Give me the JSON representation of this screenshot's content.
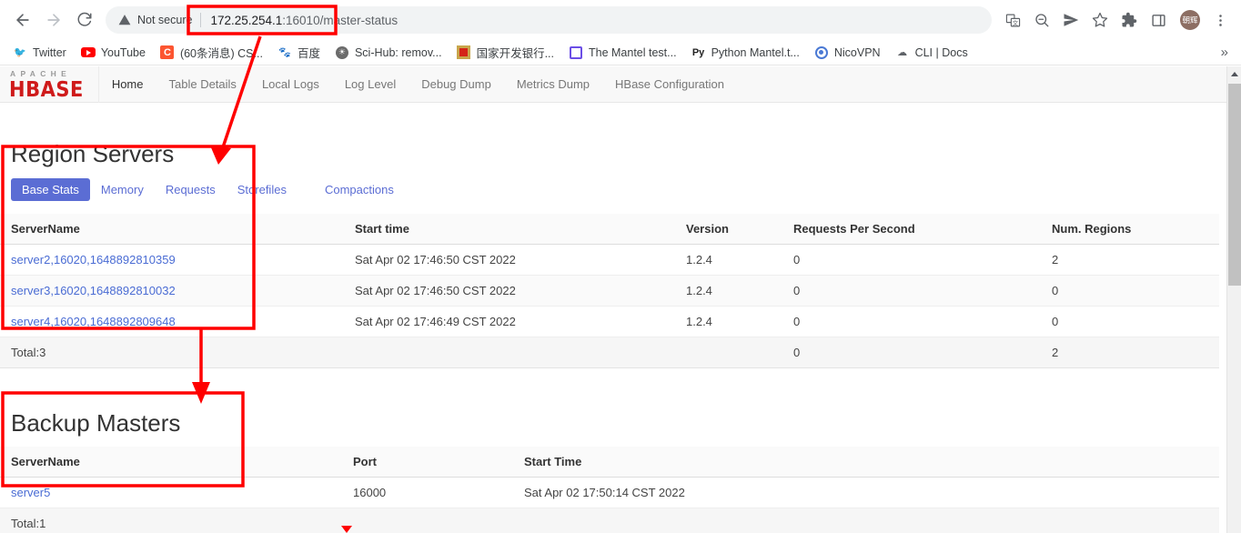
{
  "browser": {
    "back_label": "Back",
    "forward_label": "Forward",
    "reload_label": "Reload",
    "security_label": "Not secure",
    "url_host": "172.25.254.1",
    "url_rest": ":16010/master-status",
    "toolbar_icons": [
      {
        "name": "translate-icon",
        "glyph": "文"
      },
      {
        "name": "zoom-out-icon",
        "glyph": "-"
      },
      {
        "name": "send-icon",
        "glyph": "➤"
      },
      {
        "name": "bookmark-star-icon",
        "glyph": "☆"
      },
      {
        "name": "extensions-puzzle-icon",
        "glyph": "🧩"
      },
      {
        "name": "side-panel-icon",
        "glyph": "▢"
      }
    ],
    "avatar_label": "朝辉",
    "menu_label": "⋮",
    "bookmarks": [
      {
        "label": "Twitter",
        "icon": "twitter-icon"
      },
      {
        "label": "YouTube",
        "icon": "youtube-icon"
      },
      {
        "label": "(60条消息) CS...",
        "icon": "csdn-icon"
      },
      {
        "label": "百度",
        "icon": "baidu-icon"
      },
      {
        "label": "Sci-Hub: remov...",
        "icon": "scihub-icon"
      },
      {
        "label": "国家开发银行...",
        "icon": "cdb-icon"
      },
      {
        "label": "The Mantel test...",
        "icon": "mantel-icon"
      },
      {
        "label": "Python Mantel.t...",
        "icon": "python-icon"
      },
      {
        "label": "NicoVPN",
        "icon": "nicovpn-icon"
      },
      {
        "label": "CLI | Docs",
        "icon": "cli-docs-icon"
      }
    ],
    "bookmarks_overflow": "»"
  },
  "hbase": {
    "logo_top": "APACHE",
    "logo_main": "HBASE",
    "nav": [
      {
        "label": "Home",
        "active": true
      },
      {
        "label": "Table Details",
        "active": false
      },
      {
        "label": "Local Logs",
        "active": false
      },
      {
        "label": "Log Level",
        "active": false
      },
      {
        "label": "Debug Dump",
        "active": false
      },
      {
        "label": "Metrics Dump",
        "active": false
      },
      {
        "label": "HBase Configuration",
        "active": false
      }
    ],
    "region_servers": {
      "title": "Region Servers",
      "tabs": [
        {
          "label": "Base Stats",
          "active": true
        },
        {
          "label": "Memory",
          "active": false
        },
        {
          "label": "Requests",
          "active": false
        },
        {
          "label": "Storefiles",
          "active": false
        },
        {
          "label": "Compactions",
          "active": false
        }
      ],
      "headers": [
        "ServerName",
        "Start time",
        "Version",
        "Requests Per Second",
        "Num. Regions"
      ],
      "rows": [
        {
          "server": "server2,16020,1648892810359",
          "start_time": "Sat Apr 02 17:46:50 CST 2022",
          "version": "1.2.4",
          "rps": "0",
          "regions": "2"
        },
        {
          "server": "server3,16020,1648892810032",
          "start_time": "Sat Apr 02 17:46:50 CST 2022",
          "version": "1.2.4",
          "rps": "0",
          "regions": "0"
        },
        {
          "server": "server4,16020,1648892809648",
          "start_time": "Sat Apr 02 17:46:49 CST 2022",
          "version": "1.2.4",
          "rps": "0",
          "regions": "0"
        }
      ],
      "total_label": "Total:3",
      "total_rps": "0",
      "total_regions": "2"
    },
    "backup_masters": {
      "title": "Backup Masters",
      "headers": [
        "ServerName",
        "Port",
        "Start Time"
      ],
      "rows": [
        {
          "server": "server5",
          "port": "16000",
          "start_time": "Sat Apr 02 17:50:14 CST 2022"
        }
      ],
      "total_label": "Total:1"
    }
  },
  "annotations": {
    "color": "#ff0000",
    "boxes": [
      {
        "name": "url-highlight-box"
      },
      {
        "name": "region-servers-highlight-box"
      },
      {
        "name": "backup-masters-highlight-box"
      }
    ],
    "arrows": [
      {
        "name": "url-to-region-servers-arrow"
      },
      {
        "name": "region-servers-to-backup-masters-arrow"
      }
    ]
  }
}
